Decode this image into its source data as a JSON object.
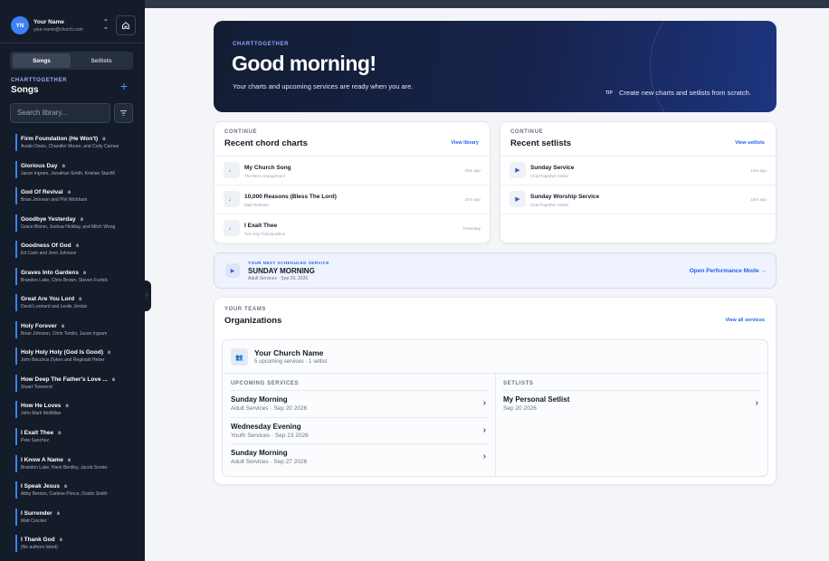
{
  "sidebar": {
    "user": {
      "initials": "YN",
      "name": "Your Name",
      "email": "your-name@church.com"
    },
    "tabs": {
      "songs": "Songs",
      "setlists": "Setlists"
    },
    "brand": "CHARTTOGETHER",
    "section_title": "Songs",
    "search_placeholder": "Search library...",
    "songs": [
      {
        "title": "Firm Foundation (He Won't)",
        "authors": "Austin Davis, Chandler Moore, and Cody Carnes"
      },
      {
        "title": "Glorious Day",
        "authors": "Jason Ingram, Jonathan Smith, Kristian Stanfill"
      },
      {
        "title": "God Of Revival",
        "authors": "Brian Johnson and Phil Wickham"
      },
      {
        "title": "Goodbye Yesterday",
        "authors": "Grace Binion, Joshua Holiday, and Mitch Wong"
      },
      {
        "title": "Goodness Of God",
        "authors": "Ed Cash and Jenn Johnson"
      },
      {
        "title": "Graves Into Gardens",
        "authors": "Brandon Lake, Chris Brown, Steven Furtick"
      },
      {
        "title": "Great Are You Lord",
        "authors": "David Leonard and Leslie Jordan"
      },
      {
        "title": "Holy Forever",
        "authors": "Brian Johnson, Chris Tomlin, Jason Ingram"
      },
      {
        "title": "Holy Holy Holy (God Is Good)",
        "authors": "John Bacchus Dykes and Reginald Heber"
      },
      {
        "title": "How Deep The Father's Love ...",
        "authors": "Stuart Townend"
      },
      {
        "title": "How He Loves",
        "authors": "John Mark McMillan"
      },
      {
        "title": "I Exalt Thee",
        "authors": "Pete Sanchez"
      },
      {
        "title": "I Know A Name",
        "authors": "Brandon Lake, Hank Bentley, Jacob Sooter"
      },
      {
        "title": "I Speak Jesus",
        "authors": "Abby Benton, Carlene Prince, Dustin Smith"
      },
      {
        "title": "I Surrender",
        "authors": "Matt Crocker"
      },
      {
        "title": "I Thank God",
        "authors": "(No authors listed)"
      }
    ]
  },
  "hero": {
    "kicker": "CHARTTOGETHER",
    "heading": "Good morning!",
    "subtitle": "Your charts and upcoming services are ready when you are.",
    "tip_label": "TIP",
    "tip_text": "Create new charts and setlists from scratch."
  },
  "charts_card": {
    "kicker": "CONTINUE",
    "title": "Recent chord charts",
    "link": "View library",
    "items": [
      {
        "title": "My Church Song",
        "sub": "The Best Arrangement",
        "time": "33m ago"
      },
      {
        "title": "10,000 Reasons (Bless The Lord)",
        "sub": "Matt Redman",
        "time": "47m ago"
      },
      {
        "title": "I Exalt Thee",
        "sub": "Two Key Transposition",
        "time": "Yesterday"
      }
    ]
  },
  "setlists_card": {
    "kicker": "CONTINUE",
    "title": "Recent setlists",
    "link": "View setlists",
    "items": [
      {
        "title": "Sunday Service",
        "sub": "ChartTogether Setlist",
        "time": "12m ago"
      },
      {
        "title": "Sunday Worship Service",
        "sub": "ChartTogether Setlist",
        "time": "15m ago"
      }
    ]
  },
  "next_service": {
    "kicker": "YOUR NEXT SCHEDULED SERVICE",
    "title": "SUNDAY MORNING",
    "sub": "Adult Services · Sep 20, 2026",
    "action": "Open Performance Mode →"
  },
  "teams": {
    "kicker": "YOUR TEAMS",
    "title": "Organizations",
    "link": "View all services",
    "org": {
      "name": "Your Church Name",
      "summary": "5 upcoming services · 1 setlist",
      "services_label": "UPCOMING SERVICES",
      "setlists_label": "SETLISTS",
      "services": [
        {
          "name": "Sunday Morning",
          "meta": "Adult Services · Sep 20 2026"
        },
        {
          "name": "Wednesday Evening",
          "meta": "Youth Services · Sep 23 2026"
        },
        {
          "name": "Sunday Morning",
          "meta": "Adult Services · Sep 27 2026"
        }
      ],
      "setlists": [
        {
          "name": "My Personal Setlist",
          "meta": "Sep 20 2026"
        }
      ]
    }
  }
}
